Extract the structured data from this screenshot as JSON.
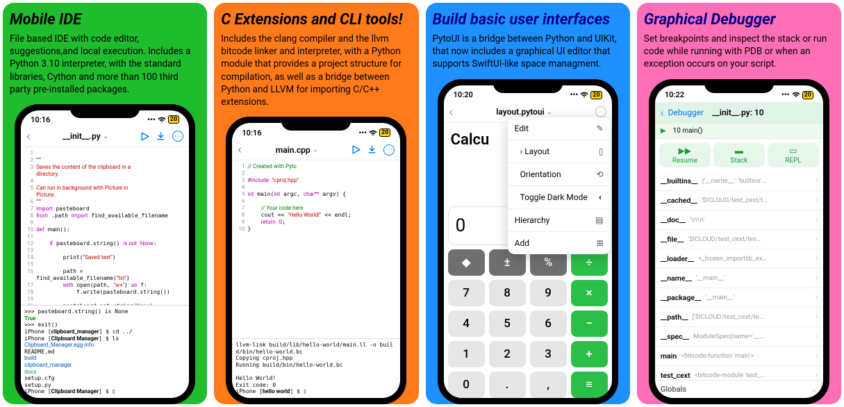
{
  "panels": [
    {
      "title": "Mobile IDE",
      "desc": "File based IDE with code editor, suggestions,and local execution. Includes a Python 3.10 interpreter, with the standard libraries, Cython and more than 100 third party pre-installed packages."
    },
    {
      "title": "C Extensions and CLI tools!",
      "desc": "Includes the clang compiler and the llvm bitcode linker and interpreter, with a Python module that provides a project structure for compilation, as well as a bridge between Python and LLVM for importing C/C++ extensions."
    },
    {
      "title": "Build basic user interfaces",
      "desc": "PytoUI is a bridge between Python and UIKit, that now includes a graphical UI editor that supports SwiftUI-like space managment."
    },
    {
      "title": "Graphical Debugger",
      "desc": "Set breakpoints and inspect the stack or run code while running with PDB or when an exception occurs on your script."
    }
  ],
  "screen1": {
    "time": "10:16",
    "battery": "20",
    "title": "__init__.py",
    "term_lines": [
      ">>> pasteboard.string() is None",
      "True",
      ">>> exit()",
      "iPhone [clipboard_manager] $ cd ../",
      "iPhone [Clipboard Manager] $ ls",
      "Clipboard_Manager.egg-info",
      "README.md",
      "build",
      "clipboard_manager",
      "docs",
      "setup.cfg",
      "setup.py",
      "iPhone [Clipboard Manager] $ "
    ]
  },
  "screen2": {
    "time": "10:16",
    "battery": "20",
    "title": "main.cpp",
    "term_lines": [
      "llvm-link build/lib/hello-world/main.ll -o build/bin/hello-world.bc",
      "Copying cproj.hpp",
      "Running build/bin/hello-world.bc",
      "",
      "Hello World!",
      "Exit code: 0",
      "iPhone [hello world] $ "
    ]
  },
  "screen3": {
    "time": "10:20",
    "battery": "20",
    "title": "layout.pytoui",
    "calc_label": "Calcu",
    "calc_value": "0",
    "popover": {
      "edit": "Edit",
      "layout": "Layout",
      "orientation": "Orientation",
      "toggle": "Toggle Dark Mode",
      "hierarchy": "Hierarchy",
      "add": "Add"
    },
    "keys": [
      [
        "◆",
        "±",
        "%",
        "÷"
      ],
      [
        "7",
        "8",
        "9",
        "×"
      ],
      [
        "4",
        "5",
        "6",
        "−"
      ],
      [
        "1",
        "2",
        "3",
        "+"
      ],
      [
        "0",
        ".",
        ",",
        "="
      ]
    ]
  },
  "screen4": {
    "time": "10:22",
    "battery": "20",
    "back_label": "Debugger",
    "file": "__init__.py: 10",
    "line": "10 main()",
    "buttons": {
      "resume": "Resume",
      "stack": "Stack",
      "repl": "REPL"
    },
    "vars": [
      {
        "name": "__builtins__",
        "val": "{'__name__': 'builtins'…"
      },
      {
        "name": "__cached__",
        "val": "'$ICLOUD/test_cext/t…"
      },
      {
        "name": "__doc__",
        "val": "'\\n\\n'"
      },
      {
        "name": "__file__",
        "val": "'$ICLOUD/test_cext/tes…"
      },
      {
        "name": "__loader__",
        "val": "<_frozen_importlib_ex…"
      },
      {
        "name": "__name__",
        "val": "'__main__'"
      },
      {
        "name": "__package__",
        "val": "'__main__'"
      },
      {
        "name": "__path__",
        "val": "['$ICLOUD/test_cext/te…"
      },
      {
        "name": "__spec__",
        "val": "ModuleSpec(name='__…"
      },
      {
        "name": "main",
        "val": "<bitcode-function 'main'>"
      },
      {
        "name": "test_cext",
        "val": "<bitcode-module 'test_…"
      }
    ],
    "globals": "Globals"
  }
}
